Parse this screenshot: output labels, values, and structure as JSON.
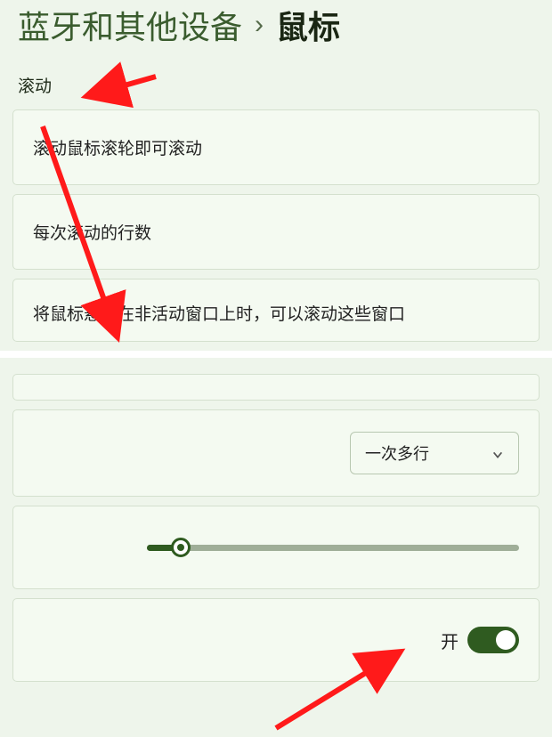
{
  "breadcrumb": {
    "parent": "蓝牙和其他设备",
    "separator": "›",
    "current": "鼠标"
  },
  "section": {
    "title": "滚动"
  },
  "rows": {
    "scroll_wheel": "滚动鼠标滚轮即可滚动",
    "lines_per_scroll": "每次滚动的行数",
    "hover_inactive": "将鼠标悬停在非活动窗口上时，可以滚动这些窗口"
  },
  "controls": {
    "dropdown_value": "一次多行",
    "slider_percent": 9,
    "toggle_label": "开",
    "toggle_on": true
  },
  "annotation_color": "#ff1a1a"
}
